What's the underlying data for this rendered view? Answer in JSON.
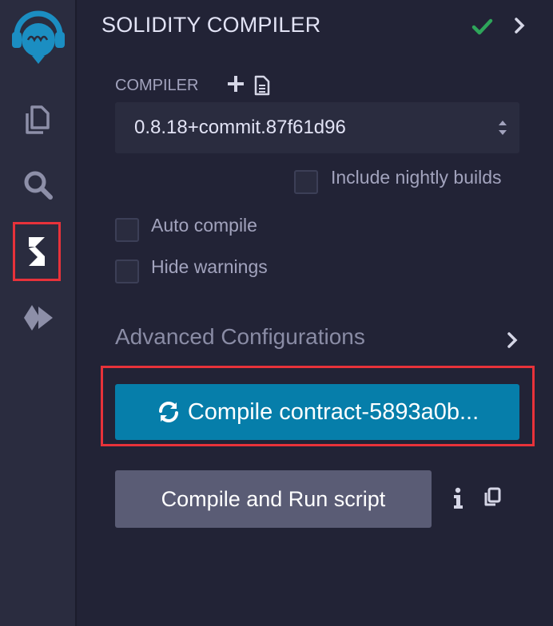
{
  "sidebar": {
    "icons": [
      "remix-logo-icon",
      "file-explorer-icon",
      "search-icon",
      "solidity-compiler-icon",
      "deploy-run-icon"
    ]
  },
  "panel": {
    "title": "SOLIDITY COMPILER"
  },
  "compiler": {
    "label": "COMPILER",
    "selected_version": "0.8.18+commit.87f61d96"
  },
  "options": {
    "nightly_label": "Include nightly builds",
    "auto_compile_label": "Auto compile",
    "hide_warnings_label": "Hide warnings"
  },
  "advanced": {
    "label": "Advanced Configurations"
  },
  "actions": {
    "compile_label": "Compile contract-5893a0b...",
    "run_script_label": "Compile and Run script"
  },
  "colors": {
    "background": "#222336",
    "icon_bar": "#2a2c3f",
    "primary_button": "#067eaa",
    "secondary_button": "#5a5c75",
    "highlight": "#e8323a",
    "success": "#2ea55a"
  }
}
